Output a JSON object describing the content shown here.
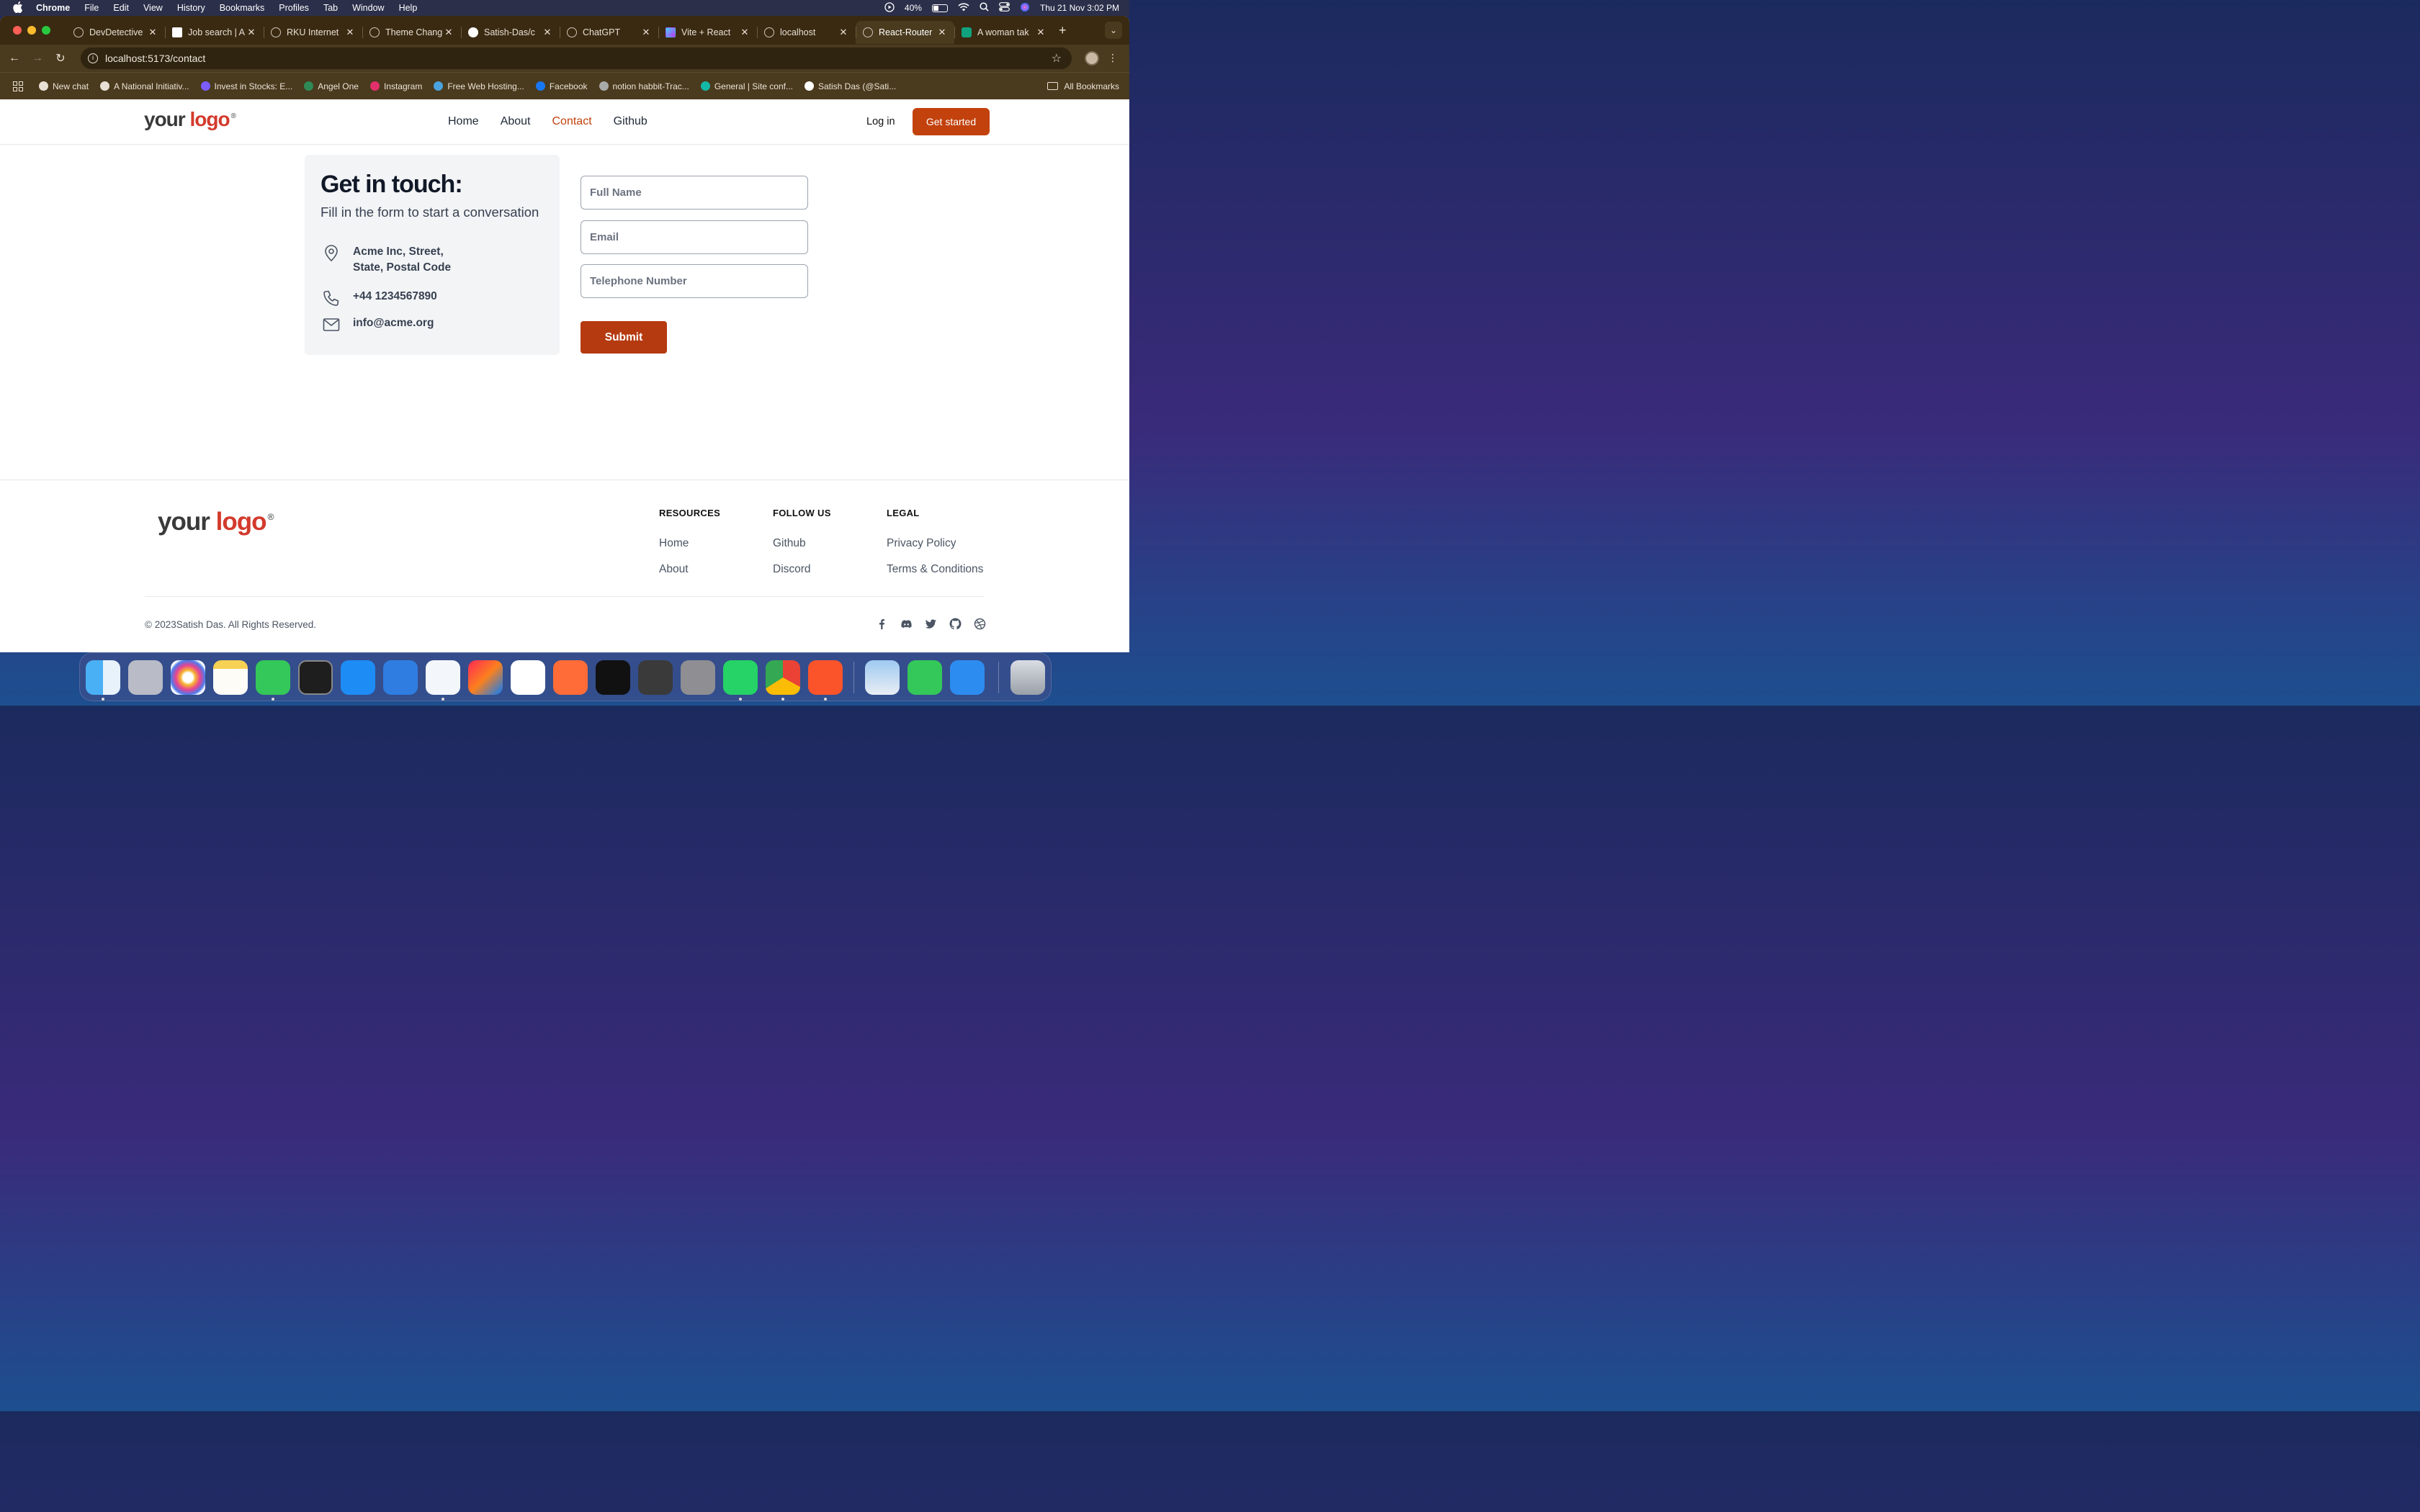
{
  "menubar": {
    "items": [
      "Chrome",
      "File",
      "Edit",
      "View",
      "History",
      "Bookmarks",
      "Profiles",
      "Tab",
      "Window",
      "Help"
    ],
    "battery_pct": "40%",
    "battery_level": 0.4,
    "datetime": "Thu 21 Nov  3:02 PM"
  },
  "tabs": [
    {
      "title": "DevDetective",
      "active": false
    },
    {
      "title": "Job search | A",
      "active": false
    },
    {
      "title": "RKU Internet",
      "active": false
    },
    {
      "title": "Theme Chang",
      "active": false
    },
    {
      "title": "Satish-Das/c",
      "active": false
    },
    {
      "title": "ChatGPT",
      "active": false
    },
    {
      "title": "Vite + React",
      "active": false
    },
    {
      "title": "localhost",
      "active": false
    },
    {
      "title": "React-Router",
      "active": true
    },
    {
      "title": "A woman tak",
      "active": false
    }
  ],
  "url": "localhost:5173/contact",
  "bookmarks": [
    {
      "label": "New chat",
      "color": "#e8e0d4"
    },
    {
      "label": "A National Initiativ...",
      "color": "#e8e0d4"
    },
    {
      "label": "Invest in Stocks: E...",
      "color": "#7b5cff"
    },
    {
      "label": "Angel One",
      "color": "#2e8b57"
    },
    {
      "label": "Instagram",
      "color": "#e1306c"
    },
    {
      "label": "Free Web Hosting...",
      "color": "#4aa3df"
    },
    {
      "label": "Facebook",
      "color": "#1877f2"
    },
    {
      "label": "notion habbit-Trac...",
      "color": "#aaaaaa"
    },
    {
      "label": "General | Site conf...",
      "color": "#14b8a6"
    },
    {
      "label": "Satish Das (@Sati...",
      "color": "#ffffff"
    }
  ],
  "all_bookmarks": "All Bookmarks",
  "site": {
    "logo_your": "your",
    "logo_logo": "logo",
    "logo_reg": "®",
    "nav": [
      "Home",
      "About",
      "Contact",
      "Github"
    ],
    "nav_active": "Contact",
    "login": "Log in",
    "get_started": "Get started"
  },
  "contact": {
    "heading": "Get in touch:",
    "subheading": "Fill in the form to start a conversation",
    "address_line1": "Acme Inc, Street,",
    "address_line2": "State, Postal Code",
    "phone": "+44 1234567890",
    "email": "info@acme.org"
  },
  "form": {
    "name_placeholder": "Full Name",
    "email_placeholder": "Email",
    "phone_placeholder": "Telephone Number",
    "submit": "Submit"
  },
  "footer": {
    "resources": {
      "heading": "RESOURCES",
      "links": [
        "Home",
        "About"
      ]
    },
    "follow": {
      "heading": "FOLLOW US",
      "links": [
        "Github",
        "Discord"
      ]
    },
    "legal": {
      "heading": "LEGAL",
      "links": [
        "Privacy Policy",
        "Terms & Conditions"
      ]
    },
    "copyright": "© 2023Satish Das. All Rights Reserved.",
    "social_icons": [
      "facebook-icon",
      "discord-icon",
      "twitter-icon",
      "github-icon",
      "dribbble-icon"
    ]
  },
  "colors": {
    "accent": "#c2410c",
    "logo_red": "#d33a2c",
    "card_bg": "#f3f4f6"
  },
  "dock_apps": [
    "Finder",
    "Launchpad",
    "Photos",
    "Notes",
    "Messages",
    "Terminal",
    "App Store",
    "Xcode",
    "VS Code",
    "IntelliJ IDEA",
    "MongoDB Compass",
    "Postman",
    "Apple TV",
    "QuickTime Player",
    "System Settings",
    "WhatsApp",
    "Google Chrome",
    "Brave",
    "Preview",
    "FaceTime",
    "Simulator",
    "Trash"
  ]
}
